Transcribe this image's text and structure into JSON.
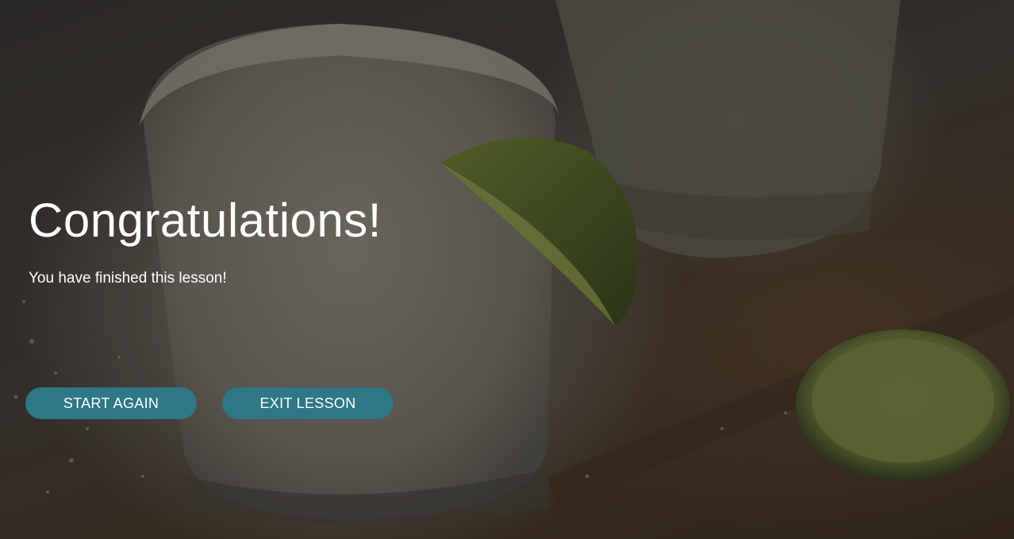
{
  "completion": {
    "title": "Congratulations!",
    "message": "You have finished this lesson!"
  },
  "actions": {
    "start_again_label": "START AGAIN",
    "exit_lesson_label": "EXIT LESSON"
  },
  "colors": {
    "button_background": "#2e7785",
    "text": "#ffffff"
  }
}
